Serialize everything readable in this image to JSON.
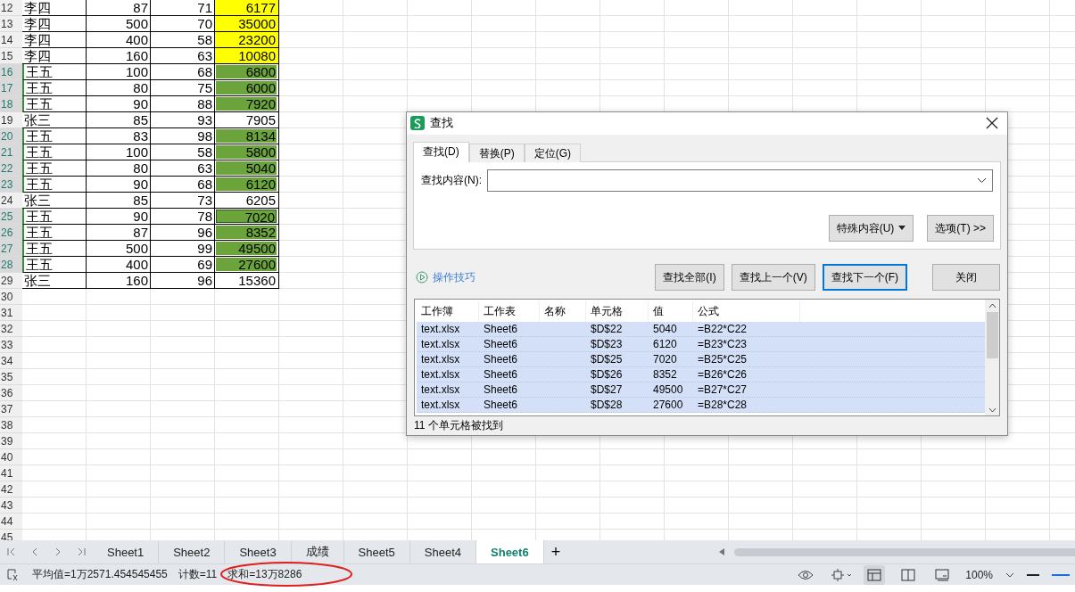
{
  "sheet_rows": [
    {
      "number": "12",
      "selected": false,
      "name": "李四",
      "col_b": "87",
      "col_c": "71",
      "col_d": "6177",
      "color": "#ffff00",
      "active": false
    },
    {
      "number": "13",
      "selected": false,
      "name": "李四",
      "col_b": "500",
      "col_c": "70",
      "col_d": "35000",
      "color": "#ffff00",
      "active": false
    },
    {
      "number": "14",
      "selected": false,
      "name": "李四",
      "col_b": "400",
      "col_c": "58",
      "col_d": "23200",
      "color": "#ffff00",
      "active": false
    },
    {
      "number": "15",
      "selected": false,
      "name": "李四",
      "col_b": "160",
      "col_c": "63",
      "col_d": "10080",
      "color": "#ffff00",
      "active": false
    },
    {
      "number": "16",
      "selected": true,
      "name": "王五",
      "col_b": "100",
      "col_c": "68",
      "col_d": "6800",
      "color": "#6aa43a",
      "active": false
    },
    {
      "number": "17",
      "selected": true,
      "name": "王五",
      "col_b": "80",
      "col_c": "75",
      "col_d": "6000",
      "color": "#6aa43a",
      "active": false
    },
    {
      "number": "18",
      "selected": true,
      "name": "王五",
      "col_b": "90",
      "col_c": "88",
      "col_d": "7920",
      "color": "#6aa43a",
      "active": false
    },
    {
      "number": "19",
      "selected": false,
      "name": "张三",
      "col_b": "85",
      "col_c": "93",
      "col_d": "7905",
      "active": false
    },
    {
      "number": "20",
      "selected": true,
      "name": "王五",
      "col_b": "83",
      "col_c": "98",
      "col_d": "8134",
      "color": "#6aa43a",
      "active": false
    },
    {
      "number": "21",
      "selected": true,
      "name": "王五",
      "col_b": "100",
      "col_c": "58",
      "col_d": "5800",
      "color": "#6aa43a",
      "active": false
    },
    {
      "number": "22",
      "selected": true,
      "name": "王五",
      "col_b": "80",
      "col_c": "63",
      "col_d": "5040",
      "color": "#6aa43a",
      "active": false
    },
    {
      "number": "23",
      "selected": true,
      "name": "王五",
      "col_b": "90",
      "col_c": "68",
      "col_d": "6120",
      "color": "#6aa43a",
      "active": false
    },
    {
      "number": "24",
      "selected": false,
      "name": "张三",
      "col_b": "85",
      "col_c": "73",
      "col_d": "6205",
      "active": false
    },
    {
      "number": "25",
      "selected": true,
      "name": "王五",
      "col_b": "90",
      "col_c": "78",
      "col_d": "7020",
      "color": "#6aa43a",
      "active": true
    },
    {
      "number": "26",
      "selected": true,
      "name": "王五",
      "col_b": "87",
      "col_c": "96",
      "col_d": "8352",
      "color": "#6aa43a",
      "active": false
    },
    {
      "number": "27",
      "selected": true,
      "name": "王五",
      "col_b": "500",
      "col_c": "99",
      "col_d": "49500",
      "color": "#6aa43a",
      "active": false
    },
    {
      "number": "28",
      "selected": true,
      "name": "王五",
      "col_b": "400",
      "col_c": "69",
      "col_d": "27600",
      "color": "#6aa43a",
      "active": false
    },
    {
      "number": "29",
      "selected": false,
      "name": "张三",
      "col_b": "160",
      "col_c": "96",
      "col_d": "15360",
      "active": false
    }
  ],
  "empty_rows": [
    "30",
    "31",
    "32",
    "33",
    "34",
    "35",
    "36",
    "37",
    "38",
    "39",
    "40",
    "41",
    "42",
    "43",
    "44",
    "45"
  ],
  "find_dialog": {
    "title": "查找",
    "tabs": [
      {
        "label": "查找(D)",
        "selected": true
      },
      {
        "label": "替换(P)",
        "selected": false
      },
      {
        "label": "定位(G)",
        "selected": false
      }
    ],
    "search_label": "查找内容(N):",
    "special_button": "特殊内容(U)",
    "options_button": "选项(T)",
    "options_arrows": ">>",
    "tips_link": "操作技巧",
    "buttons": [
      {
        "label": "查找全部(I)",
        "selected": false
      },
      {
        "label": "查找上一个(V)",
        "selected": false
      },
      {
        "label": "查找下一个(F)",
        "selected": true
      }
    ],
    "close_button": "关闭",
    "results": {
      "columns": [
        "工作簿",
        "工作表",
        "名称",
        "单元格",
        "值",
        "公式"
      ],
      "rows": [
        {
          "selected": true,
          "cells": [
            "text.xlsx",
            "Sheet6",
            "",
            "$D$22",
            "5040",
            "=B22*C22"
          ]
        },
        {
          "selected": true,
          "cells": [
            "text.xlsx",
            "Sheet6",
            "",
            "$D$23",
            "6120",
            "=B23*C23"
          ]
        },
        {
          "selected": true,
          "cells": [
            "text.xlsx",
            "Sheet6",
            "",
            "$D$25",
            "7020",
            "=B25*C25"
          ]
        },
        {
          "selected": true,
          "cells": [
            "text.xlsx",
            "Sheet6",
            "",
            "$D$26",
            "8352",
            "=B26*C26"
          ]
        },
        {
          "selected": true,
          "cells": [
            "text.xlsx",
            "Sheet6",
            "",
            "$D$27",
            "49500",
            "=B27*C27"
          ]
        },
        {
          "selected": true,
          "cells": [
            "text.xlsx",
            "Sheet6",
            "",
            "$D$28",
            "27600",
            "=B28*C28"
          ]
        }
      ]
    },
    "status": "11 个单元格被找到"
  },
  "sheet_tabs": [
    {
      "label": "Sheet1",
      "selected": false
    },
    {
      "label": "Sheet2",
      "selected": false
    },
    {
      "label": "Sheet3",
      "selected": false
    },
    {
      "label": "成绩",
      "selected": false
    },
    {
      "label": "Sheet5",
      "selected": false
    },
    {
      "label": "Sheet4",
      "selected": false
    },
    {
      "label": "Sheet6",
      "selected": true
    }
  ],
  "add_sheet": "+",
  "status_bar": {
    "average": "平均值=1万2571.454545455",
    "count": "计数=11",
    "sum": "求和=13万8286",
    "zoom": "100%",
    "views": [
      {
        "kind": "normal",
        "selected": true
      },
      {
        "kind": "split",
        "selected": false
      },
      {
        "kind": "page",
        "selected": false
      }
    ]
  }
}
